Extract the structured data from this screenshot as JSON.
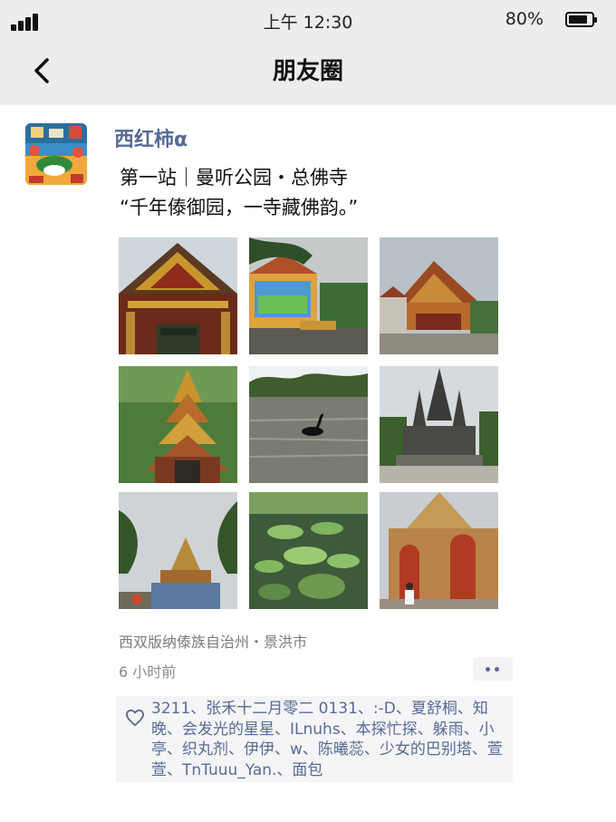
{
  "status_bar": {
    "time": "上午 12:30",
    "battery_percent": "80%",
    "battery_level": 0.8
  },
  "nav": {
    "title": "朋友圈",
    "back_icon": "chevron-left-icon"
  },
  "post": {
    "author": "西红柿α",
    "text": "第一站｜曼听公园・总佛寺\n“千年傣御园，一寺藏佛韵。”",
    "photos": [
      "temple-gate-photo",
      "painted-wall-photo",
      "temple-hall-photo",
      "golden-pagoda-photo",
      "black-swan-lake-photo",
      "stone-stupa-photo",
      "garden-shrine-photo",
      "lily-pond-photo",
      "red-temple-wall-photo"
    ],
    "location": "西双版纳傣族自治州・景洪市",
    "time_ago": "6 小时前",
    "likes": "3211、张禾十二月零二 0131、:-D、夏舒桐、知晚、会发光的星星、ILnuhs、本探忙探、躲雨、小亭、织丸剂、伊伊、w、陈曦蕊、少女的巴别塔、萱萱、TnTuuu_Yan.、面包"
  },
  "colors": {
    "link": "#576b95",
    "header_bg": "#ededed",
    "like_bg": "#f5f5f7"
  }
}
